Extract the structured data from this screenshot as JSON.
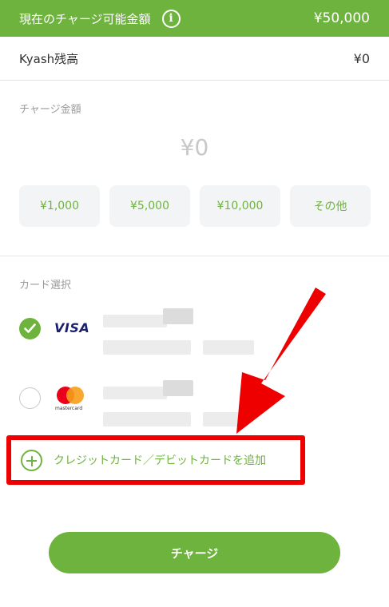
{
  "header": {
    "label": "現在のチャージ可能金額",
    "info_glyph": "i",
    "amount": "¥50,000"
  },
  "balance": {
    "label": "Kyash残高",
    "value": "¥0"
  },
  "charge": {
    "section_label": "チャージ金額",
    "amount": "¥0",
    "presets": [
      "¥1,000",
      "¥5,000",
      "¥10,000",
      "その他"
    ]
  },
  "cards": {
    "section_label": "カード選択",
    "items": [
      {
        "brand": "VISA",
        "selected": true,
        "icon": "visa-logo"
      },
      {
        "brand": "mastercard",
        "selected": false,
        "icon": "mastercard-logo"
      }
    ],
    "add_label": "クレジットカード／デビットカードを追加"
  },
  "submit_label": "チャージ",
  "colors": {
    "accent": "#6fb33f",
    "highlight": "#ee0000"
  }
}
